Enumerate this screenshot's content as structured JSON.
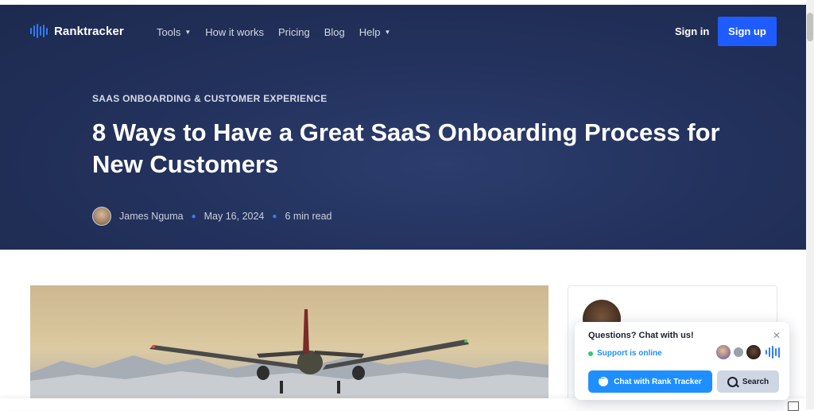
{
  "header": {
    "logo_text": "Ranktracker",
    "nav": [
      {
        "label": "Tools",
        "has_dropdown": true
      },
      {
        "label": "How it works",
        "has_dropdown": false
      },
      {
        "label": "Pricing",
        "has_dropdown": false
      },
      {
        "label": "Blog",
        "has_dropdown": false
      },
      {
        "label": "Help",
        "has_dropdown": true
      }
    ],
    "signin_label": "Sign in",
    "signup_label": "Sign up"
  },
  "article": {
    "category": "SAAS ONBOARDING & CUSTOMER EXPERIENCE",
    "title": "8 Ways to Have a Great SaaS Onboarding Process for New Customers",
    "author": "James Nguma",
    "date": "May 16, 2024",
    "read_time": "6 min read"
  },
  "chat_widget": {
    "title": "Questions? Chat with us!",
    "status": "Support is online",
    "chat_button_label": "Chat with Rank Tracker",
    "search_button_label": "Search",
    "close_icon": "close-icon"
  },
  "icons": {
    "logo": "ranktracker-bars-icon",
    "caret": "chevron-down-icon",
    "chat": "chat-bubble-icon",
    "search": "search-icon"
  },
  "colors": {
    "hero_bg": "#23325d",
    "accent": "#1f5cff",
    "chat_accent": "#1f8fff",
    "online": "#2ecc71"
  }
}
